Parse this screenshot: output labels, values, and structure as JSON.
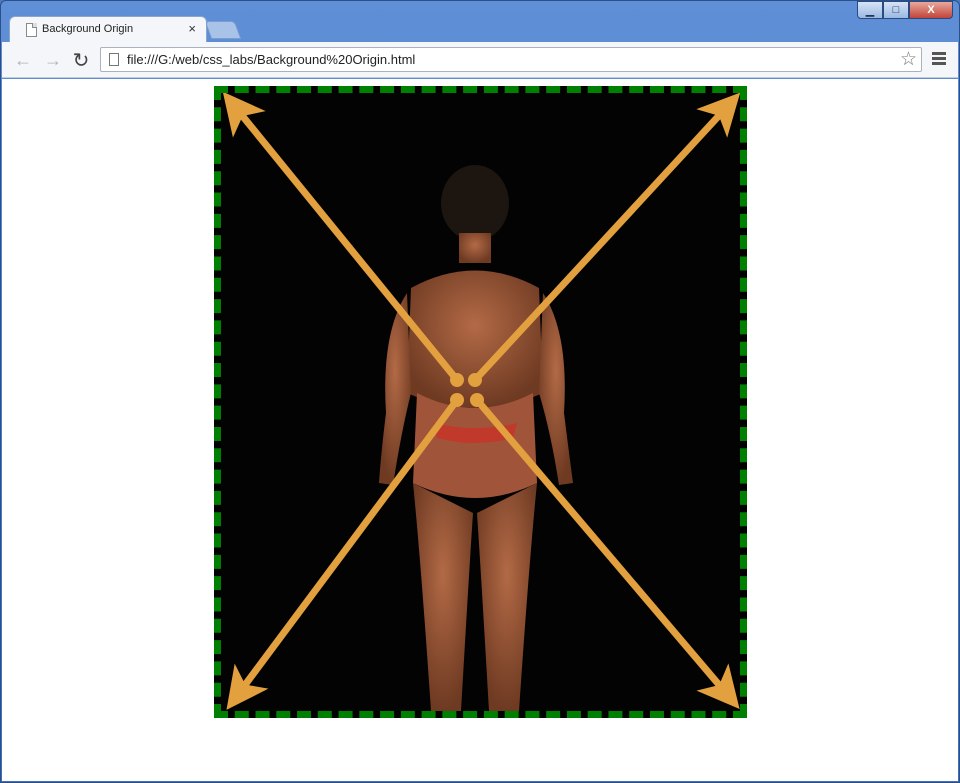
{
  "tab": {
    "title": "Background Origin",
    "close_glyph": "×"
  },
  "window_controls": {
    "minimize": "▁",
    "maximize": "□",
    "close": "X"
  },
  "toolbar": {
    "back_icon": "arrow-left-icon",
    "forward_icon": "arrow-right-icon",
    "reload_icon": "reload-icon",
    "url": "file:///G:/web/css_labs/Background%20Origin.html",
    "star_icon": "star-icon",
    "menu_icon": "menu-icon"
  },
  "page": {
    "demo_image": "photo of a bodybuilder from behind on black background, overlaid with four orange diagonal arrows pointing to the corners",
    "border_color": "#008000",
    "arrow_color": "#e2a03f"
  }
}
